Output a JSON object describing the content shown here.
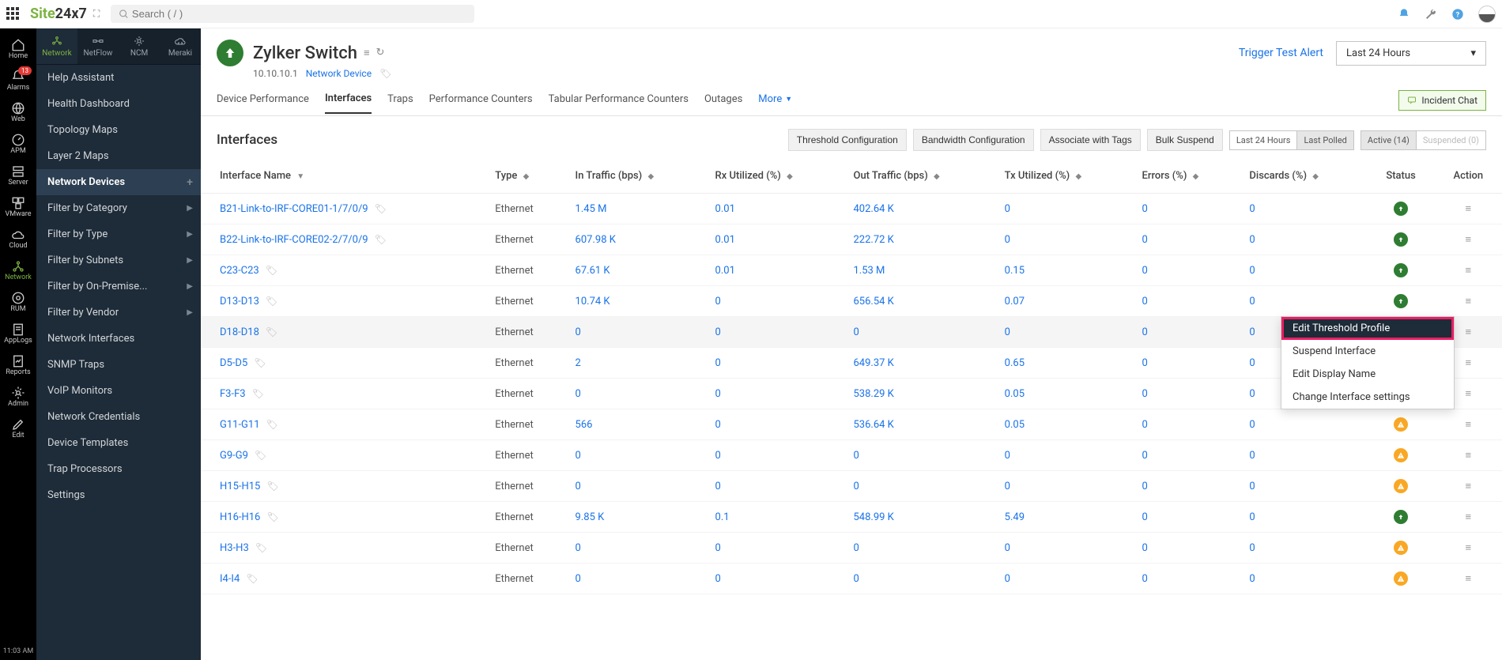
{
  "search_placeholder": "Search ( / )",
  "logo_text": "Site24x7",
  "iconbar": [
    {
      "label": "Home"
    },
    {
      "label": "Alarms",
      "badge": "13"
    },
    {
      "label": "Web"
    },
    {
      "label": "APM"
    },
    {
      "label": "Server"
    },
    {
      "label": "VMware"
    },
    {
      "label": "Cloud"
    },
    {
      "label": "Network",
      "active": true
    },
    {
      "label": "RUM"
    },
    {
      "label": "AppLogs"
    },
    {
      "label": "Reports"
    },
    {
      "label": "Admin"
    },
    {
      "label": "Edit"
    }
  ],
  "clock": "11:03 AM",
  "subtabs": [
    {
      "label": "Network",
      "active": true
    },
    {
      "label": "NetFlow"
    },
    {
      "label": "NCM"
    },
    {
      "label": "Meraki"
    }
  ],
  "menu": [
    {
      "label": "Help Assistant"
    },
    {
      "label": "Health Dashboard"
    },
    {
      "label": "Topology Maps"
    },
    {
      "label": "Layer 2 Maps"
    },
    {
      "label": "Network Devices",
      "active": true,
      "plus": true
    },
    {
      "label": "Filter by Category",
      "chev": true
    },
    {
      "label": "Filter by Type",
      "chev": true
    },
    {
      "label": "Filter by Subnets",
      "chev": true
    },
    {
      "label": "Filter by On-Premise...",
      "chev": true
    },
    {
      "label": "Filter by Vendor",
      "chev": true
    },
    {
      "label": "Network Interfaces"
    },
    {
      "label": "SNMP Traps"
    },
    {
      "label": "VoIP Monitors"
    },
    {
      "label": "Network Credentials"
    },
    {
      "label": "Device Templates"
    },
    {
      "label": "Trap Processors"
    },
    {
      "label": "Settings"
    }
  ],
  "device": {
    "name": "Zylker Switch",
    "ip": "10.10.10.1",
    "type_link": "Network Device"
  },
  "trigger_link": "Trigger Test Alert",
  "time_select": "Last 24 Hours",
  "incident_btn": "Incident Chat",
  "tabs": [
    {
      "label": "Device Performance"
    },
    {
      "label": "Interfaces",
      "active": true
    },
    {
      "label": "Traps"
    },
    {
      "label": "Performance Counters"
    },
    {
      "label": "Tabular Performance Counters"
    },
    {
      "label": "Outages"
    }
  ],
  "tabs_more": "More",
  "section_title": "Interfaces",
  "btns": {
    "threshold": "Threshold Configuration",
    "bandwidth": "Bandwidth Configuration",
    "assoc": "Associate with Tags",
    "bulk": "Bulk Suspend"
  },
  "range_toggle": {
    "a": "Last 24 Hours",
    "b": "Last Polled"
  },
  "status_toggle": {
    "active": "Active (14)",
    "susp": "Suspended (0)"
  },
  "columns": [
    "Interface Name",
    "Type",
    "In Traffic (bps)",
    "Rx Utilized (%)",
    "Out Traffic (bps)",
    "Tx Utilized (%)",
    "Errors (%)",
    "Discards (%)",
    "Status",
    "Action"
  ],
  "rows": [
    {
      "name": "B21-Link-to-IRF-CORE01-1/7/0/9",
      "type": "Ethernet",
      "in": "1.45 M",
      "rx": "0.01",
      "out": "402.64 K",
      "tx": "0",
      "err": "0",
      "disc": "0",
      "status": "up"
    },
    {
      "name": "B22-Link-to-IRF-CORE02-2/7/0/9",
      "type": "Ethernet",
      "in": "607.98 K",
      "rx": "0.01",
      "out": "222.72 K",
      "tx": "0",
      "err": "0",
      "disc": "0",
      "status": "up"
    },
    {
      "name": "C23-C23",
      "type": "Ethernet",
      "in": "67.61 K",
      "rx": "0.01",
      "out": "1.53 M",
      "tx": "0.15",
      "err": "0",
      "disc": "0",
      "status": "up"
    },
    {
      "name": "D13-D13",
      "type": "Ethernet",
      "in": "10.74 K",
      "rx": "0",
      "out": "656.54 K",
      "tx": "0.07",
      "err": "0",
      "disc": "0",
      "status": "up"
    },
    {
      "name": "D18-D18",
      "type": "Ethernet",
      "in": "0",
      "rx": "0",
      "out": "0",
      "tx": "0",
      "err": "0",
      "disc": "0",
      "status": "warn",
      "hover": true
    },
    {
      "name": "D5-D5",
      "type": "Ethernet",
      "in": "2",
      "rx": "0",
      "out": "649.37 K",
      "tx": "0.65",
      "err": "0",
      "disc": "0",
      "status": "up"
    },
    {
      "name": "F3-F3",
      "type": "Ethernet",
      "in": "0",
      "rx": "0",
      "out": "538.29 K",
      "tx": "0.05",
      "err": "0",
      "disc": "0",
      "status": "warn"
    },
    {
      "name": "G11-G11",
      "type": "Ethernet",
      "in": "566",
      "rx": "0",
      "out": "536.64 K",
      "tx": "0.05",
      "err": "0",
      "disc": "0",
      "status": "warn"
    },
    {
      "name": "G9-G9",
      "type": "Ethernet",
      "in": "0",
      "rx": "0",
      "out": "0",
      "tx": "0",
      "err": "0",
      "disc": "0",
      "status": "warn"
    },
    {
      "name": "H15-H15",
      "type": "Ethernet",
      "in": "0",
      "rx": "0",
      "out": "0",
      "tx": "0",
      "err": "0",
      "disc": "0",
      "status": "warn"
    },
    {
      "name": "H16-H16",
      "type": "Ethernet",
      "in": "9.85 K",
      "rx": "0.1",
      "out": "548.99 K",
      "tx": "5.49",
      "err": "0",
      "disc": "0",
      "status": "up"
    },
    {
      "name": "H3-H3",
      "type": "Ethernet",
      "in": "0",
      "rx": "0",
      "out": "0",
      "tx": "0",
      "err": "0",
      "disc": "0",
      "status": "warn"
    },
    {
      "name": "I4-I4",
      "type": "Ethernet",
      "in": "0",
      "rx": "0",
      "out": "0",
      "tx": "0",
      "err": "0",
      "disc": "0",
      "status": "warn"
    }
  ],
  "ctx_menu": [
    {
      "label": "Edit Threshold Profile",
      "hl": true
    },
    {
      "label": "Suspend Interface"
    },
    {
      "label": "Edit Display Name"
    },
    {
      "label": "Change Interface settings"
    }
  ]
}
